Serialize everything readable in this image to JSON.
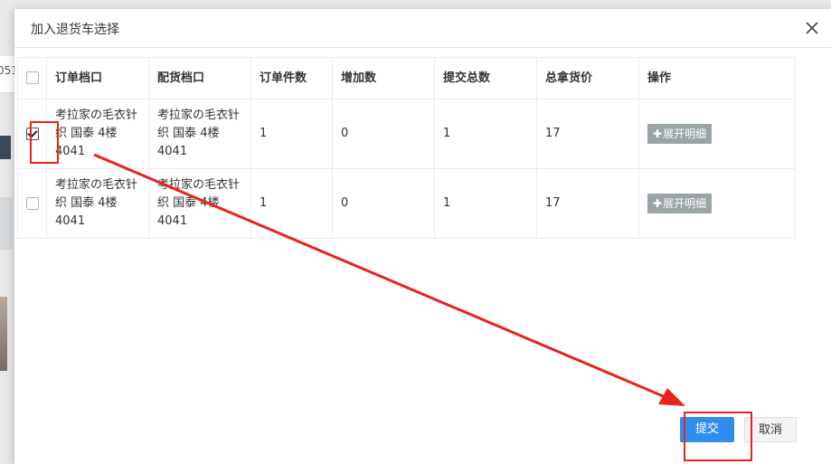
{
  "background": {
    "left_fragment": "051"
  },
  "dialog": {
    "title": "加入退货车选择",
    "table": {
      "headers": [
        "订单档口",
        "配货档口",
        "订单件数",
        "增加数",
        "提交总数",
        "总拿货价",
        "操作"
      ],
      "rows": [
        {
          "checked": true,
          "order_stall": "考拉家の毛衣针织 国泰 4楼 4041",
          "dist_stall": "考拉家の毛衣针织 国泰 4楼 4041",
          "order_qty": "1",
          "add_qty": "0",
          "submit_total": "1",
          "total_price": "17",
          "action_label": "展开明细"
        },
        {
          "checked": false,
          "order_stall": "考拉家の毛衣针织 国泰 4楼 4041",
          "dist_stall": "考拉家の毛衣针织 国泰 4楼 4041",
          "order_qty": "1",
          "add_qty": "0",
          "submit_total": "1",
          "total_price": "17",
          "action_label": "展开明细"
        }
      ]
    },
    "buttons": {
      "submit": "提交",
      "cancel": "取消"
    }
  },
  "colors": {
    "primary_button": "#2e8ded",
    "expand_button": "#9aa4a6",
    "annotation_red": "#e8231d"
  }
}
